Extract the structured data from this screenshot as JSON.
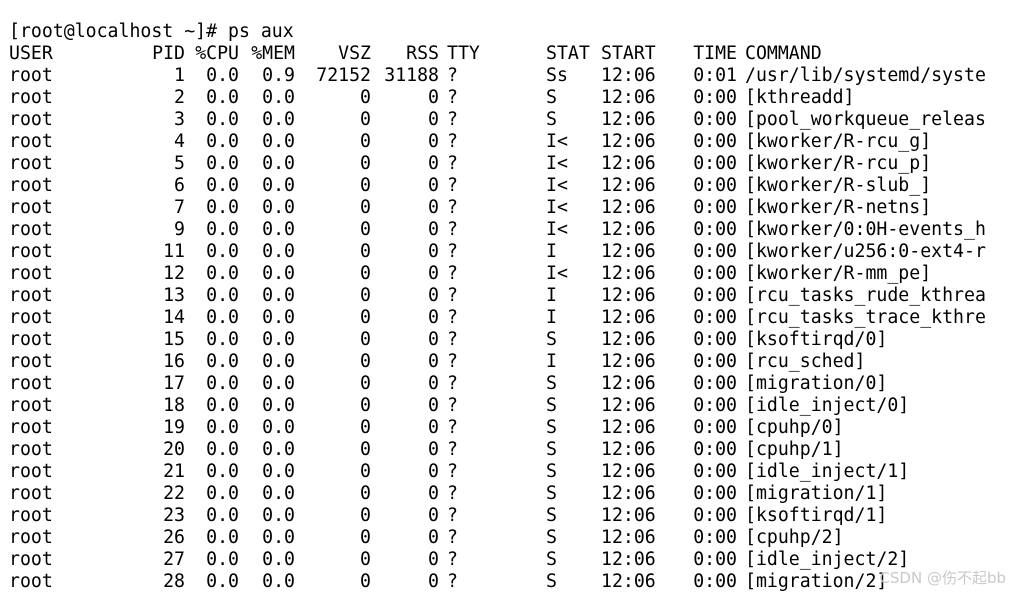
{
  "prompt": "[root@localhost ~]# ps aux",
  "headers": [
    "USER",
    "PID",
    "%CPU",
    "%MEM",
    "VSZ",
    "RSS",
    "TTY",
    "STAT",
    "START",
    "TIME",
    "COMMAND"
  ],
  "rows": [
    [
      "root",
      "1",
      "0.0",
      "0.9",
      "72152",
      "31188",
      "?",
      "Ss",
      "12:06",
      "0:01",
      "/usr/lib/systemd/syste"
    ],
    [
      "root",
      "2",
      "0.0",
      "0.0",
      "0",
      "0",
      "?",
      "S",
      "12:06",
      "0:00",
      "[kthreadd]"
    ],
    [
      "root",
      "3",
      "0.0",
      "0.0",
      "0",
      "0",
      "?",
      "S",
      "12:06",
      "0:00",
      "[pool_workqueue_releas"
    ],
    [
      "root",
      "4",
      "0.0",
      "0.0",
      "0",
      "0",
      "?",
      "I<",
      "12:06",
      "0:00",
      "[kworker/R-rcu_g]"
    ],
    [
      "root",
      "5",
      "0.0",
      "0.0",
      "0",
      "0",
      "?",
      "I<",
      "12:06",
      "0:00",
      "[kworker/R-rcu_p]"
    ],
    [
      "root",
      "6",
      "0.0",
      "0.0",
      "0",
      "0",
      "?",
      "I<",
      "12:06",
      "0:00",
      "[kworker/R-slub_]"
    ],
    [
      "root",
      "7",
      "0.0",
      "0.0",
      "0",
      "0",
      "?",
      "I<",
      "12:06",
      "0:00",
      "[kworker/R-netns]"
    ],
    [
      "root",
      "9",
      "0.0",
      "0.0",
      "0",
      "0",
      "?",
      "I<",
      "12:06",
      "0:00",
      "[kworker/0:0H-events_h"
    ],
    [
      "root",
      "11",
      "0.0",
      "0.0",
      "0",
      "0",
      "?",
      "I",
      "12:06",
      "0:00",
      "[kworker/u256:0-ext4-r"
    ],
    [
      "root",
      "12",
      "0.0",
      "0.0",
      "0",
      "0",
      "?",
      "I<",
      "12:06",
      "0:00",
      "[kworker/R-mm_pe]"
    ],
    [
      "root",
      "13",
      "0.0",
      "0.0",
      "0",
      "0",
      "?",
      "I",
      "12:06",
      "0:00",
      "[rcu_tasks_rude_kthrea"
    ],
    [
      "root",
      "14",
      "0.0",
      "0.0",
      "0",
      "0",
      "?",
      "I",
      "12:06",
      "0:00",
      "[rcu_tasks_trace_kthre"
    ],
    [
      "root",
      "15",
      "0.0",
      "0.0",
      "0",
      "0",
      "?",
      "S",
      "12:06",
      "0:00",
      "[ksoftirqd/0]"
    ],
    [
      "root",
      "16",
      "0.0",
      "0.0",
      "0",
      "0",
      "?",
      "I",
      "12:06",
      "0:00",
      "[rcu_sched]"
    ],
    [
      "root",
      "17",
      "0.0",
      "0.0",
      "0",
      "0",
      "?",
      "S",
      "12:06",
      "0:00",
      "[migration/0]"
    ],
    [
      "root",
      "18",
      "0.0",
      "0.0",
      "0",
      "0",
      "?",
      "S",
      "12:06",
      "0:00",
      "[idle_inject/0]"
    ],
    [
      "root",
      "19",
      "0.0",
      "0.0",
      "0",
      "0",
      "?",
      "S",
      "12:06",
      "0:00",
      "[cpuhp/0]"
    ],
    [
      "root",
      "20",
      "0.0",
      "0.0",
      "0",
      "0",
      "?",
      "S",
      "12:06",
      "0:00",
      "[cpuhp/1]"
    ],
    [
      "root",
      "21",
      "0.0",
      "0.0",
      "0",
      "0",
      "?",
      "S",
      "12:06",
      "0:00",
      "[idle_inject/1]"
    ],
    [
      "root",
      "22",
      "0.0",
      "0.0",
      "0",
      "0",
      "?",
      "S",
      "12:06",
      "0:00",
      "[migration/1]"
    ],
    [
      "root",
      "23",
      "0.0",
      "0.0",
      "0",
      "0",
      "?",
      "S",
      "12:06",
      "0:00",
      "[ksoftirqd/1]"
    ],
    [
      "root",
      "26",
      "0.0",
      "0.0",
      "0",
      "0",
      "?",
      "S",
      "12:06",
      "0:00",
      "[cpuhp/2]"
    ],
    [
      "root",
      "27",
      "0.0",
      "0.0",
      "0",
      "0",
      "?",
      "S",
      "12:06",
      "0:00",
      "[idle_inject/2]"
    ],
    [
      "root",
      "28",
      "0.0",
      "0.0",
      "0",
      "0",
      "?",
      "S",
      "12:06",
      "0:00",
      "[migration/2]"
    ]
  ],
  "watermark": "CSDN @伤不起bb"
}
